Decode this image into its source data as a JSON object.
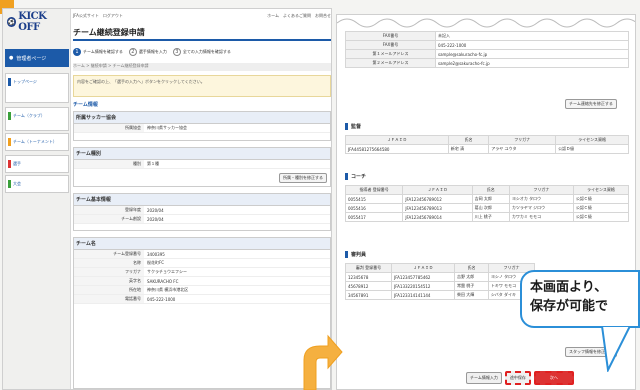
{
  "left": {
    "logo_text": "KICK OFF",
    "manager_label": "管理者ページ",
    "sidebar_items": [
      {
        "label": "トップページ"
      },
      {
        "label": "チーム（クラブ）"
      },
      {
        "label": "チーム（トーナメント）"
      },
      {
        "label": "選手"
      },
      {
        "label": "大会"
      }
    ],
    "top_links": [
      "JFA公式サイト",
      "ログアウト"
    ],
    "top_links_right": [
      "ホーム",
      "よくあるご質問",
      "お問合せ"
    ],
    "page_title": "チーム継続登録申請",
    "steps": [
      {
        "num": "1",
        "label": "チーム情報を確認する",
        "active": true
      },
      {
        "num": "2",
        "label": "選手情報を入力",
        "active": false
      },
      {
        "num": "3",
        "label": "全ての入力情報を確認する",
        "active": false
      }
    ],
    "breadcrumbs": "ホーム > 継続申請 > チーム継続登録申請",
    "notice": "内容をご確認の上、「選手の入力へ」ボタンをクリックしてください。",
    "section_team_info": "チーム情報",
    "sub_affiliation": "所属サッカー協会",
    "affiliation_key": "所属協会",
    "affiliation_val": "神奈川県サッカー協会",
    "sub_category": "チーム種別",
    "category_key": "種別",
    "category_val": "第１種",
    "category_btn": "所属・種別を修正する",
    "sub_basic": "チーム基本情報",
    "basic_rows": [
      {
        "k": "登録年度",
        "v": "2020/04"
      },
      {
        "k": "チーム創設",
        "v": "2020/04"
      }
    ],
    "sub_team": "チーム名",
    "team_rows": [
      {
        "k": "チーム登録番号",
        "v": "3400395"
      },
      {
        "k": "名称",
        "v": "桜花町FC"
      },
      {
        "k": "フリガナ",
        "v": "サクラチョウエフシー"
      },
      {
        "k": "英字名",
        "v": "SAKURACHO FC"
      },
      {
        "k": "所在地",
        "v": "神奈川県 横浜市港北区"
      },
      {
        "k": "電話番号",
        "v": "045-222-1000"
      }
    ]
  },
  "right": {
    "contact_rows": [
      {
        "k": "FAX番号",
        "v": "未記入"
      },
      {
        "k": "FAX番号",
        "v": "045-222-1000"
      },
      {
        "k": "第１メールアドレス",
        "v": "sample@sakuracho-fc.jp"
      },
      {
        "k": "第２メールアドレス",
        "v": "sample2@sakuracho-fc.jp"
      }
    ],
    "contact_btn": "チーム連絡先を修正する",
    "sec_rep": "監督",
    "rep_headers": [
      "ＪＦＡＩＤ",
      "氏名",
      "フリガナ",
      "ライセンス資格"
    ],
    "rep_rows": [
      [
        "JFA44581275664580",
        "新宅 清",
        "アラヤ ユウタ",
        "公認Ｄ級"
      ]
    ],
    "sec_coach": "コーチ",
    "coach_headers": [
      "指導者\n登録番号",
      "ＪＦＡＩＤ",
      "氏名",
      "フリガナ",
      "ライセンス資格"
    ],
    "coach_rows": [
      [
        "0055415",
        "JFA123456789012",
        "吉岡 太郎",
        "ヨシオカ タロウ",
        "公認Ｃ級"
      ],
      [
        "0055416",
        "JFA123456789013",
        "葛山 次郎",
        "カツラヤマ ジロウ",
        "公認Ｃ級"
      ],
      [
        "0055417",
        "JFA123456789014",
        "川上 桃子",
        "カワカミ モモコ",
        "公認Ｃ級"
      ]
    ],
    "sec_staff": "審判員",
    "staff_headers": [
      "審判\n登録番号",
      "ＪＦＡＩＤ",
      "氏名",
      "フリガナ"
    ],
    "staff_rows": [
      [
        "12345678",
        "JFA123457785462",
        "吉野 太郎",
        "ヨシノ タロウ"
      ],
      [
        "45678912",
        "JFA133220154512",
        "常盤 桃子",
        "トキワ モモコ"
      ],
      [
        "34567891",
        "JFA123314141144",
        "柴田 大輝",
        "シバタ ダイキ"
      ]
    ],
    "staff_btn": "スタッフ情報を修正する",
    "callout_text": "本画面より、\n保存が可能で",
    "bottom_buttons": [
      "チーム情報入力",
      "途中保存",
      "次へ"
    ]
  }
}
